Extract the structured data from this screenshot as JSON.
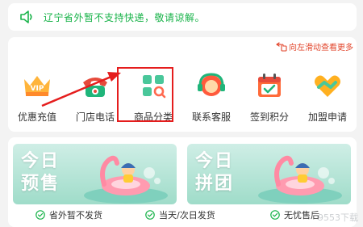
{
  "notice": {
    "text": "辽宁省外暂不支持快递，敬请谅解。",
    "icon": "speaker-icon"
  },
  "hint": {
    "text": "向左滑动查看更多",
    "icon": "hand-pointer-icon"
  },
  "menu": [
    {
      "label": "优惠充值",
      "icon": "vip-crown-icon",
      "color": "#ff8a2b"
    },
    {
      "label": "门店电话",
      "icon": "telephone-icon",
      "color": "#e64a3b"
    },
    {
      "label": "商品分类",
      "icon": "category-grid-icon",
      "color": "#19c06a"
    },
    {
      "label": "联系客服",
      "icon": "headset-icon",
      "color": "#ff5a3c"
    },
    {
      "label": "签到积分",
      "icon": "calendar-check-icon",
      "color": "#ff6b3a"
    },
    {
      "label": "加盟申请",
      "icon": "handshake-heart-icon",
      "color": "#ffb020"
    }
  ],
  "banners": [
    {
      "line1": "今日",
      "line2": "预售"
    },
    {
      "line1": "今日",
      "line2": "拼团"
    }
  ],
  "footer": [
    {
      "text": "省外暂不发货"
    },
    {
      "text": "当天/次日发货"
    },
    {
      "text": "无忧售后"
    }
  ],
  "watermark": "9553下载"
}
